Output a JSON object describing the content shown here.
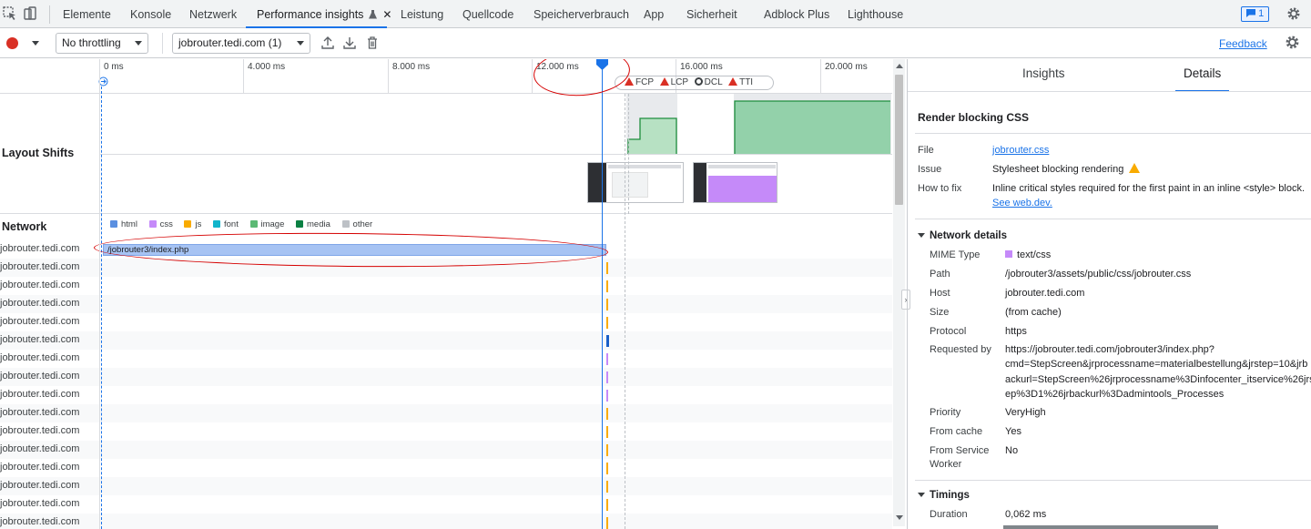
{
  "tabs": [
    {
      "label": "Elemente"
    },
    {
      "label": "Konsole"
    },
    {
      "label": "Netzwerk"
    },
    {
      "label": "Performance insights",
      "active": true
    },
    {
      "label": "Leistung"
    },
    {
      "label": "Quellcode"
    },
    {
      "label": "Speicherverbrauch"
    },
    {
      "label": "App"
    },
    {
      "label": "Sicherheit"
    },
    {
      "label": "Adblock Plus"
    },
    {
      "label": "Lighthouse"
    }
  ],
  "issues_badge": "1",
  "toolbar": {
    "throttling": "No throttling",
    "recording": "jobrouter.tedi.com (1)",
    "feedback": "Feedback"
  },
  "ruler": {
    "ticks": [
      "0 ms",
      "4.000 ms",
      "8.000 ms",
      "12.000 ms",
      "16.000 ms",
      "20.000 ms"
    ],
    "markers": [
      "FCP",
      "LCP",
      "DCL",
      "TTI"
    ]
  },
  "sections": {
    "layout_shifts": "Layout Shifts",
    "network": "Network"
  },
  "legend": [
    {
      "label": "html",
      "color": "#5a8fe0"
    },
    {
      "label": "css",
      "color": "#c58af9"
    },
    {
      "label": "js",
      "color": "#f9ab00"
    },
    {
      "label": "font",
      "color": "#12b5cb"
    },
    {
      "label": "image",
      "color": "#5bb974"
    },
    {
      "label": "media",
      "color": "#0b8043"
    },
    {
      "label": "other",
      "color": "#bdc1c6"
    }
  ],
  "network_rows": [
    "jobrouter.tedi.com",
    "jobrouter.tedi.com",
    "jobrouter.tedi.com",
    "jobrouter.tedi.com",
    "jobrouter.tedi.com",
    "jobrouter.tedi.com",
    "jobrouter.tedi.com",
    "jobrouter.tedi.com",
    "jobrouter.tedi.com",
    "jobrouter.tedi.com",
    "jobrouter.tedi.com",
    "jobrouter.tedi.com",
    "jobrouter.tedi.com",
    "jobrouter.tedi.com",
    "jobrouter.tedi.com",
    "jobrouter.tedi.com"
  ],
  "network_bar": "/jobrouter3/index.php",
  "right_tabs": [
    "Insights",
    "Details"
  ],
  "details": {
    "title": "Render blocking CSS",
    "file_label": "File",
    "file_value": "jobrouter.css",
    "issue_label": "Issue",
    "issue_value": "Stylesheet blocking rendering",
    "fix_label": "How to fix",
    "fix_value": "Inline critical styles required for the first paint in an inline <style> block.",
    "fix_link": "See web.dev.",
    "network_details": "Network details",
    "mime_label": "MIME Type",
    "mime_value": "text/css",
    "path_label": "Path",
    "path_value": "/jobrouter3/assets/public/css/jobrouter.css",
    "host_label": "Host",
    "host_value": "jobrouter.tedi.com",
    "size_label": "Size",
    "size_value": "(from cache)",
    "protocol_label": "Protocol",
    "protocol_value": "https",
    "requested_label": "Requested by",
    "requested_1": "https://jobrouter.tedi.com/jobrouter3/index.php?",
    "requested_2": "cmd=StepScreen&jrprocessname=materialbestellung&jrstep=10&jrb",
    "requested_3": "ackurl=StepScreen%26jrprocessname%3Dinfocenter_itservice%26jrst",
    "requested_4": "ep%3D1%26jrbackurl%3Dadmintools_Processes",
    "priority_label": "Priority",
    "priority_value": "VeryHigh",
    "cache_label": "From cache",
    "cache_value": "Yes",
    "sw_label_1": "From Service",
    "sw_label_2": "Worker",
    "sw_value": "No",
    "timings": "Timings",
    "duration_label": "Duration",
    "duration_value": "0,062 ms"
  }
}
